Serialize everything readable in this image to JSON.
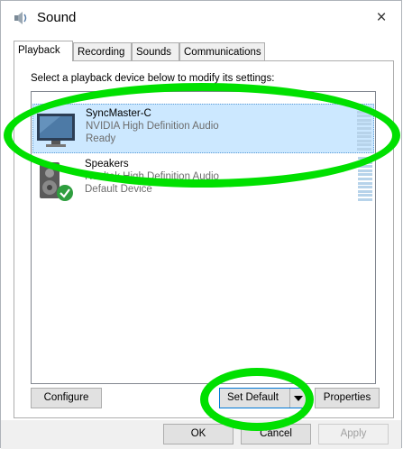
{
  "window": {
    "title": "Sound",
    "close_label": "×"
  },
  "tabs": [
    {
      "label": "Playback",
      "active": true
    },
    {
      "label": "Recording",
      "active": false
    },
    {
      "label": "Sounds",
      "active": false
    },
    {
      "label": "Communications",
      "active": false
    }
  ],
  "instruction": "Select a playback device below to modify its settings:",
  "devices": [
    {
      "name": "SyncMaster-C",
      "driver": "NVIDIA High Definition Audio",
      "status": "Ready",
      "icon": "monitor-icon",
      "selected": true
    },
    {
      "name": "Speakers",
      "driver": "Realtek High Definition Audio",
      "status": "Default Device",
      "icon": "speaker-icon",
      "default_check": true
    }
  ],
  "buttons": {
    "configure": "Configure",
    "set_default": "Set Default",
    "properties": "Properties",
    "ok": "OK",
    "cancel": "Cancel",
    "apply": "Apply"
  },
  "annotations": {
    "highlight_color": "#00e000"
  }
}
